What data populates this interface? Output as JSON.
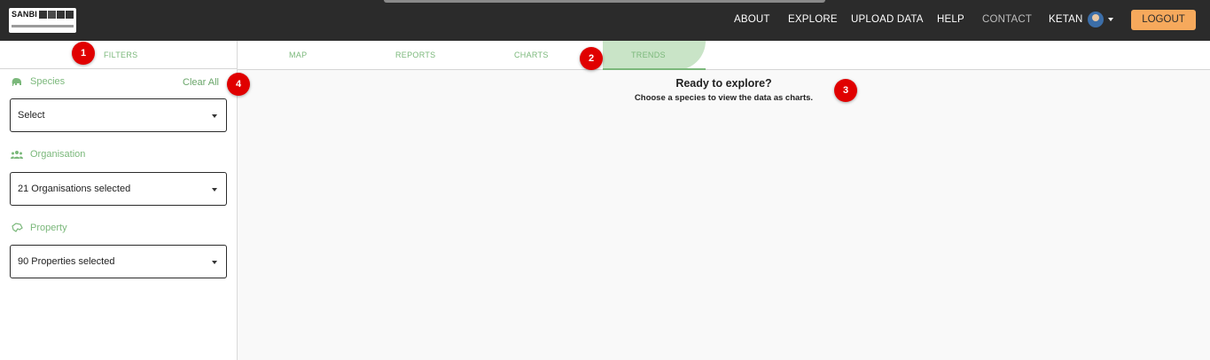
{
  "header": {
    "logo_text": "SANBI",
    "nav": [
      "ABOUT",
      "EXPLORE",
      "UPLOAD DATA",
      "HELP",
      "CONTACT"
    ],
    "user": "KETAN",
    "logout": "LOGOUT"
  },
  "sidebar": {
    "tab_label": "FILTERS",
    "clear_all": "Clear All",
    "species": {
      "label": "Species",
      "value": "Select"
    },
    "organisation": {
      "label": "Organisation",
      "value": "21 Organisations selected"
    },
    "property": {
      "label": "Property",
      "value": "90 Properties selected"
    }
  },
  "tabs": [
    "MAP",
    "REPORTS",
    "CHARTS",
    "TRENDS"
  ],
  "active_tab": "TRENDS",
  "empty_state": {
    "title": "Ready to explore?",
    "subtitle": "Choose a species to view the data as charts."
  },
  "badges": [
    "1",
    "2",
    "3",
    "4"
  ],
  "colors": {
    "accent_green": "#7bb87b",
    "logout_orange": "#f6a95c",
    "badge_red": "#e00000",
    "header_bg": "#2b2b2b"
  }
}
